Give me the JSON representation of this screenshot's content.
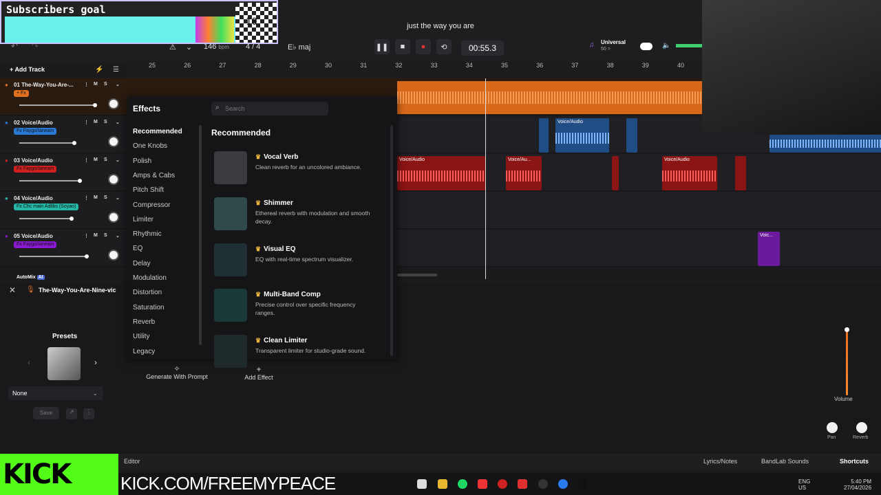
{
  "overlay": {
    "title": "Subscribers goal",
    "count": "10"
  },
  "topbar": {
    "song_title": "just the way you are",
    "bpm": "146",
    "bpm_unit": "bpm",
    "time_sig": "4 / 4",
    "key": "E♭ maj",
    "time": "00:55.3",
    "preset": "Universal",
    "preset_sub": "50 >"
  },
  "ruler": [
    "25",
    "26",
    "27",
    "28",
    "29",
    "30",
    "31",
    "32",
    "33",
    "34",
    "35",
    "36",
    "37",
    "38",
    "39",
    "40"
  ],
  "tracks": [
    {
      "num": "01",
      "name": "The-Way-You-Are-...",
      "fx": "+ Fx",
      "color": "#e07020"
    },
    {
      "num": "02",
      "name": "Voice/Audio",
      "fx": "Fx Faygo/Ianeam",
      "color": "#2a7ad8"
    },
    {
      "num": "03",
      "name": "Voice/Audio",
      "fx": "Fx Faygo/Ianeam",
      "color": "#d02020"
    },
    {
      "num": "04",
      "name": "Voice/Audio",
      "fx": "Fx Chc main Adlibs (Soyao)",
      "color": "#25b8a8"
    },
    {
      "num": "05",
      "name": "Voice/Audio",
      "fx": "Fx Faygo/Ianeam",
      "color": "#8a1ad0"
    }
  ],
  "add_track": "Add Track",
  "automix": "AutoMix",
  "automix_badge": "AI",
  "selected_track": "The-Way-You-Are-Nine-vic",
  "effects": {
    "title": "Effects",
    "search_placeholder": "Search",
    "categories": [
      "Recommended",
      "One Knobs",
      "Polish",
      "Amps & Cabs",
      "Pitch Shift",
      "Compressor",
      "Limiter",
      "Rhythmic",
      "EQ",
      "Delay",
      "Modulation",
      "Distortion",
      "Saturation",
      "Reverb",
      "Utility",
      "Legacy"
    ],
    "section_title": "Recommended",
    "items": [
      {
        "name": "Vocal Verb",
        "desc": "Clean reverb for an uncolored ambiance."
      },
      {
        "name": "Shimmer",
        "desc": "Ethereal reverb with modulation and smooth decay."
      },
      {
        "name": "Visual EQ",
        "desc": "EQ with real-time spectrum visualizer."
      },
      {
        "name": "Multi-Band Comp",
        "desc": "Precise control over specific frequency ranges."
      },
      {
        "name": "Clean Limiter",
        "desc": "Transparent limiter for studio-grade sound."
      }
    ]
  },
  "clip_labels": {
    "c1": "Voice/Audio",
    "c2": "Voice/Audio",
    "c3": "Voice/Au...",
    "c4": "Voice/Audio",
    "c5": "Voic..."
  },
  "lower": {
    "presets_title": "Presets",
    "preset_value": "None",
    "save": "Save",
    "generate": "Generate With Prompt",
    "add_effect": "Add Effect",
    "volume": "Volume",
    "pan": "Pan",
    "reverb": "Reverb"
  },
  "status": {
    "editor": "Editor",
    "lyrics": "Lyrics/Notes",
    "sounds": "BandLab Sounds",
    "shortcuts": "Shortcuts"
  },
  "stream": {
    "kick": "KICK",
    "url": "KICK.COM/FREEMYPEACE"
  },
  "tray": {
    "lang": "ENG",
    "region": "US",
    "time": "5:40 PM",
    "date": "27/04/2026"
  }
}
